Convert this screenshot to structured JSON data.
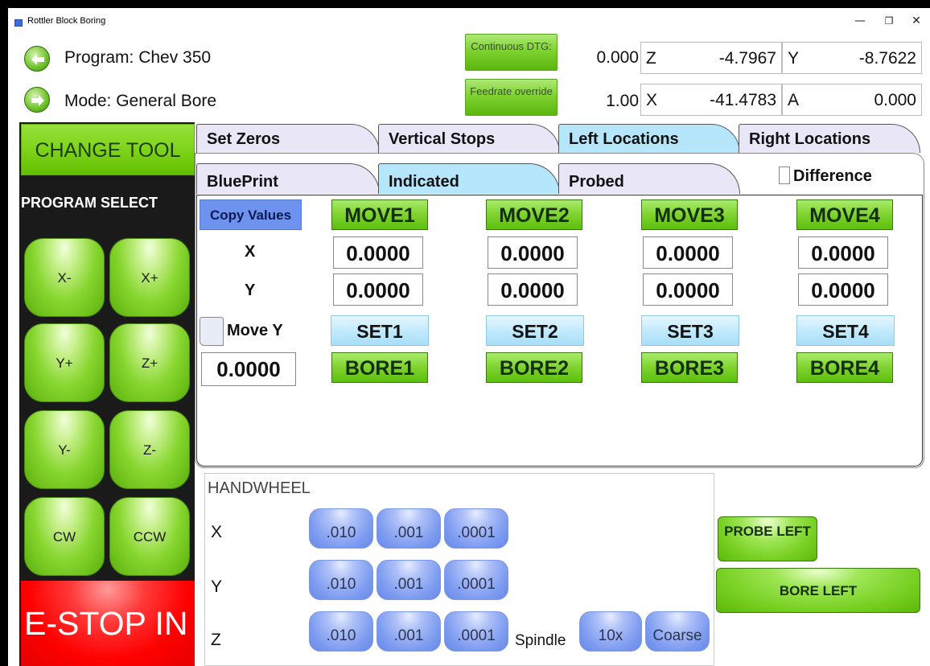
{
  "window": {
    "title": "Rottler Block Boring",
    "minimize_glyph": "—",
    "restore_glyph": "❐",
    "close_glyph": "✕"
  },
  "header": {
    "program_label": "Program: Chev 350",
    "mode_label": "Mode: General Bore",
    "continuous_dtg_label": "Continuous DTG:",
    "continuous_dtg_value": "0.000",
    "feedrate_label": "Feedrate override",
    "feedrate_value": "1.00",
    "axes": {
      "z": {
        "label": "Z",
        "value": "-4.7967"
      },
      "y": {
        "label": "Y",
        "value": "-8.7622"
      },
      "x": {
        "label": "X",
        "value": "-41.4783"
      },
      "a": {
        "label": "A",
        "value": "0.000"
      }
    }
  },
  "left_panel": {
    "change_tool": "CHANGE TOOL",
    "program_select": "PROGRAM SELECT",
    "jog": [
      "X-",
      "X+",
      "Y+",
      "Z+",
      "Y-",
      "Z-",
      "CW",
      "CCW"
    ],
    "estop": "E-STOP IN"
  },
  "tabs_row1": [
    "Set Zeros",
    "Vertical Stops",
    "Left Locations",
    "Right Locations"
  ],
  "tabs_row1_selected": "Left Locations",
  "tabs_row2": [
    "BluePrint",
    "Indicated",
    "Probed"
  ],
  "tabs_row2_selected": "Indicated",
  "difference_label": "Difference",
  "locations": {
    "copy_values": "Copy Values",
    "x_label": "X",
    "y_label": "Y",
    "move_y_label": "Move Y",
    "move_y_value": "0.0000",
    "move": [
      "MOVE1",
      "MOVE2",
      "MOVE3",
      "MOVE4"
    ],
    "x_values": [
      "0.0000",
      "0.0000",
      "0.0000",
      "0.0000"
    ],
    "y_values": [
      "0.0000",
      "0.0000",
      "0.0000",
      "0.0000"
    ],
    "set": [
      "SET1",
      "SET2",
      "SET3",
      "SET4"
    ],
    "bore": [
      "BORE1",
      "BORE2",
      "BORE3",
      "BORE4"
    ]
  },
  "handwheel": {
    "title": "HANDWHEEL",
    "axes": [
      "X",
      "Y",
      "Z"
    ],
    "increments": [
      ".010",
      ".001",
      ".0001"
    ],
    "spindle_label": "Spindle",
    "spindle_10x": "10x",
    "spindle_coarse": "Coarse"
  },
  "probe_left": "PROBE LEFT",
  "bore_left": "BORE LEFT"
}
